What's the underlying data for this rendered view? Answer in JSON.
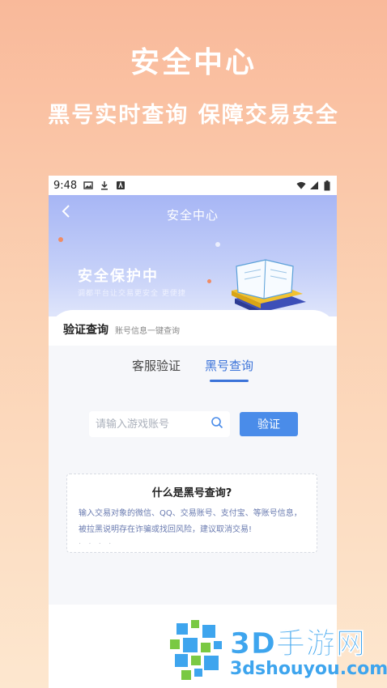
{
  "promo": {
    "title": "安全中心",
    "subtitle": "黑号实时查询 保障交易安全"
  },
  "statusbar": {
    "time": "9:48",
    "icons": [
      "image-icon",
      "download-icon",
      "app-icon",
      "wifi-icon",
      "signal-icon",
      "battery-icon"
    ]
  },
  "header": {
    "back_icon": "chevron-left-icon",
    "title": "安全中心"
  },
  "hero": {
    "title": "安全保护中",
    "description": "调都平台让交易更安全 更便捷"
  },
  "section": {
    "title": "验证查询",
    "subtitle": "账号信息一键查询"
  },
  "tabs": [
    {
      "label": "客服验证",
      "active": false
    },
    {
      "label": "黑号查询",
      "active": true
    }
  ],
  "search": {
    "placeholder": "请输入游戏账号",
    "value": "",
    "button_label": "验证"
  },
  "info": {
    "question": "什么是黑号查询?",
    "answer": "输入交易对象的微信、QQ、交易账号、支付宝、等账号信息，被拉黑说明存在诈骗或找回风险，建议取消交易!",
    "more": "· · · ·"
  },
  "watermark": {
    "brand": "3D手游网",
    "url": "3dshouyou.com"
  },
  "colors": {
    "accent": "#3b73d9",
    "button": "#4a8ce9",
    "hero_top": "#a7b6f5",
    "background_top": "#f9b99a",
    "background_bottom": "#fde7cf"
  }
}
